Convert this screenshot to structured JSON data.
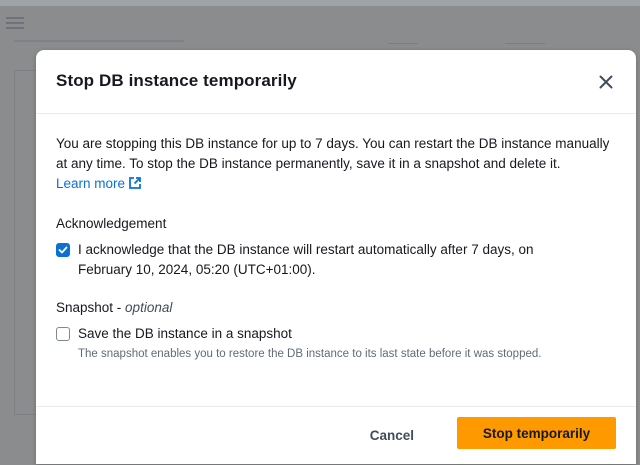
{
  "modal": {
    "title": "Stop DB instance temporarily",
    "intro_text": "You are stopping this DB instance for up to 7 days. You can restart the DB instance manually at any time. To stop the DB instance permanently, save it in a snapshot and delete it.",
    "learn_more": "Learn more",
    "acknowledgement": {
      "label": "Acknowledgement",
      "checked": true,
      "text": "I acknowledge that the DB instance will restart automatically after 7 days, on February 10, 2024, 05:20 (UTC+01:00)."
    },
    "snapshot": {
      "label": "Snapshot",
      "optional": "optional",
      "checked": false,
      "text": "Save the DB instance in a snapshot",
      "description": "The snapshot enables you to restore the DB instance to its last state before it was stopped."
    },
    "cancel_label": "Cancel",
    "primary_label": "Stop temporarily"
  },
  "icons": {
    "close": "close-icon",
    "external_link": "external-link-icon",
    "checkmark": "check-icon",
    "menu": "menu-icon"
  },
  "colors": {
    "primary_button": "#ff9900",
    "link": "#0972d3",
    "checkbox_checked": "#0972d3"
  }
}
